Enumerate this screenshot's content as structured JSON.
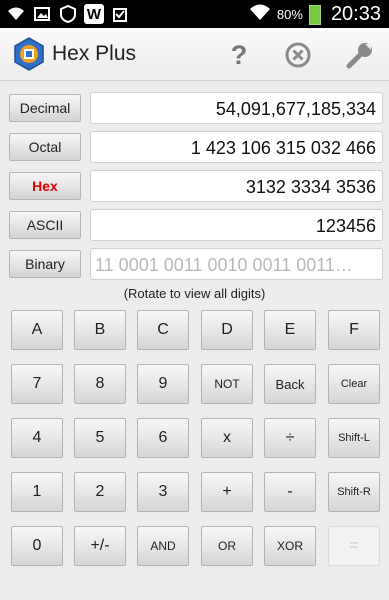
{
  "status": {
    "battery": "80%",
    "time": "20:33",
    "app_badge": "W"
  },
  "header": {
    "title": "Hex Plus",
    "help": "?"
  },
  "fields": [
    {
      "label": "Decimal",
      "value": "54,091,677,185,334",
      "active": false
    },
    {
      "label": "Octal",
      "value": "1 423 106 315 032 466",
      "active": false
    },
    {
      "label": "Hex",
      "value": "3132 3334 3536",
      "active": true
    },
    {
      "label": "ASCII",
      "value": "123456",
      "active": false
    },
    {
      "label": "Binary",
      "value": "11 0001 0011 0010 0011 0011…",
      "active": false
    }
  ],
  "hint": "(Rotate to view all digits)",
  "keypad": [
    [
      "A",
      "B",
      "C",
      "D",
      "E",
      "F"
    ],
    [
      "7",
      "8",
      "9",
      "NOT",
      "Back",
      "Clear"
    ],
    [
      "4",
      "5",
      "6",
      "x",
      "÷",
      "Shift-L"
    ],
    [
      "1",
      "2",
      "3",
      "+",
      "-",
      "Shift-R"
    ],
    [
      "0",
      "+/-",
      "AND",
      "OR",
      "XOR",
      "="
    ]
  ]
}
